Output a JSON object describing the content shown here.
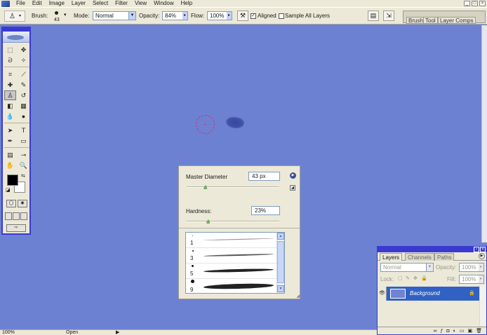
{
  "menubar": {
    "items": [
      "File",
      "Edit",
      "Image",
      "Layer",
      "Select",
      "Filter",
      "View",
      "Window",
      "Help"
    ],
    "window_controls": [
      "_",
      "□",
      "×"
    ]
  },
  "options": {
    "brush_label": "Brush:",
    "brush_size": "43",
    "mode_label": "Mode:",
    "mode_value": "Normal",
    "opacity_label": "Opacity:",
    "opacity_value": "84%",
    "flow_label": "Flow:",
    "flow_value": "100%",
    "aligned_label": "Aligned",
    "aligned_checked": true,
    "sample_all_label": "Sample All Layers",
    "sample_all_checked": false,
    "well_tabs": [
      "Brush",
      "Tool",
      "Layer Comps"
    ]
  },
  "toolbox": {
    "tools": [
      {
        "name": "marquee-tool",
        "glyph": "⬚"
      },
      {
        "name": "move-tool",
        "glyph": "✥"
      },
      {
        "name": "lasso-tool",
        "glyph": "ᘐ"
      },
      {
        "name": "magic-wand-tool",
        "glyph": "✧"
      },
      {
        "name": "crop-tool",
        "glyph": "⌗"
      },
      {
        "name": "slice-tool",
        "glyph": "⟋"
      },
      {
        "name": "healing-brush-tool",
        "glyph": "✚"
      },
      {
        "name": "brush-tool",
        "glyph": "✎"
      },
      {
        "name": "clone-stamp-tool",
        "glyph": "♙",
        "active": true
      },
      {
        "name": "history-brush-tool",
        "glyph": "↺"
      },
      {
        "name": "eraser-tool",
        "glyph": "◧"
      },
      {
        "name": "gradient-tool",
        "glyph": "▦"
      },
      {
        "name": "blur-tool",
        "glyph": "💧"
      },
      {
        "name": "dodge-tool",
        "glyph": "●"
      },
      {
        "name": "path-selection-tool",
        "glyph": "➤"
      },
      {
        "name": "type-tool",
        "glyph": "T"
      },
      {
        "name": "pen-tool",
        "glyph": "✒"
      },
      {
        "name": "shape-tool",
        "glyph": "▭"
      },
      {
        "name": "notes-tool",
        "glyph": "▤"
      },
      {
        "name": "eyedropper-tool",
        "glyph": "⊸"
      },
      {
        "name": "hand-tool",
        "glyph": "✋"
      },
      {
        "name": "zoom-tool",
        "glyph": "🔍"
      }
    ],
    "colors": {
      "foreground": "#000000",
      "background": "#ffffff"
    }
  },
  "brush_panel": {
    "diameter_label": "Master Diameter",
    "diameter_value": "43 px",
    "diameter_level": 0.2,
    "hardness_label": "Hardness:",
    "hardness_value": "23%",
    "hardness_level": 0.23,
    "presets": [
      {
        "size": "1"
      },
      {
        "size": "3"
      },
      {
        "size": "5"
      },
      {
        "size": "9"
      }
    ]
  },
  "layers": {
    "tabs": [
      "Layers",
      "Channels",
      "Paths"
    ],
    "blend_mode": "Normal",
    "opacity_label": "Opacity:",
    "opacity_value": "100%",
    "lock_label": "Lock:",
    "fill_label": "Fill:",
    "fill_value": "100%",
    "layer_name": "Background"
  },
  "status": {
    "zoom": "100%",
    "doc_label": "Open"
  },
  "canvas": {
    "color": "#6d81d3"
  }
}
